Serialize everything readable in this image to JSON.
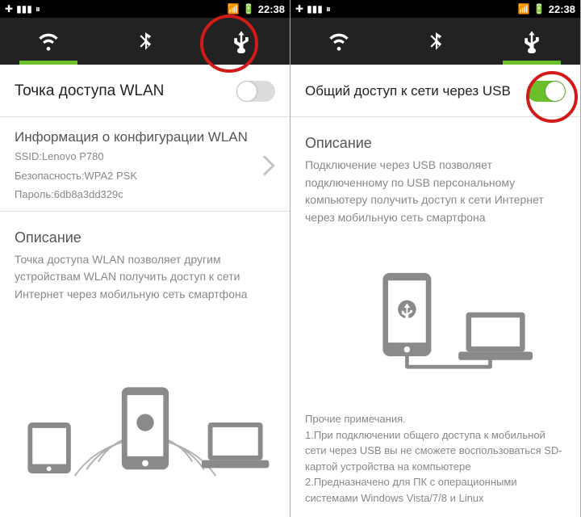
{
  "status": {
    "time": "22:38"
  },
  "tabs": [
    "wifi",
    "bluetooth",
    "usb"
  ],
  "left": {
    "active_tab": 0,
    "toggle": {
      "title": "Точка доступа WLAN",
      "on": false
    },
    "config": {
      "title": "Информация о конфигурации WLAN",
      "ssid_line": "SSID:Lenovo P780",
      "security_line": "Безопасность:WPA2 PSK",
      "password_line": "Пароль:6db8a3dd329c"
    },
    "desc_title": "Описание",
    "desc_text": "Точка доступа WLAN позволяет другим устройствам WLAN получить доступ к сети Интернет через мобильную сеть смартфона"
  },
  "right": {
    "active_tab": 2,
    "toggle": {
      "title": "Общий доступ к сети через USB",
      "on": true
    },
    "desc_title": "Описание",
    "desc_text": "Подключение через USB позволяет подключенному по USB персональному компьютеру получить доступ к сети Интернет через мобильную сеть смартфона",
    "notes_title": "Прочие примечания.",
    "note1": "1.При подключении общего доступа к мобильной сети через USB вы не сможете воспользоваться SD-картой устройства на компьютере",
    "note2": "2.Предназначено для ПК с операционными системами Windows Vista/7/8 и Linux"
  }
}
